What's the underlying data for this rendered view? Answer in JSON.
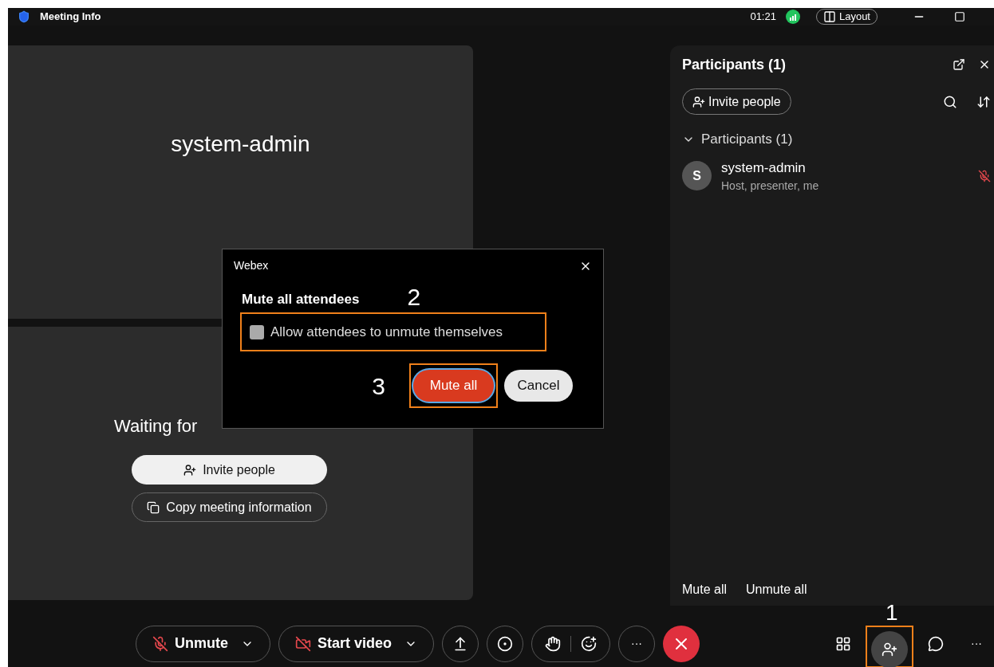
{
  "title_bar": {
    "title": "Meeting Info",
    "time": "01:21",
    "layout_button": "Layout"
  },
  "stage": {
    "main_name": "system-admin",
    "waiting_text": "Waiting for",
    "invite_button": "Invite people",
    "copy_button": "Copy meeting information"
  },
  "participants_panel": {
    "title": "Participants (1)",
    "invite_button": "Invite people",
    "group": {
      "label": "Participants (1)",
      "expanded": true
    },
    "participants": [
      {
        "initial": "S",
        "name": "system-admin",
        "role": "Host, presenter, me",
        "muted": true
      }
    ],
    "footer": [
      "Mute all",
      "Unmute all"
    ]
  },
  "dialog": {
    "title": "Webex",
    "heading": "Mute all attendees",
    "checkbox": {
      "label": "Allow attendees to unmute themselves",
      "checked": false
    },
    "primary_button": "Mute all",
    "secondary_button": "Cancel"
  },
  "toolbar": {
    "audio_button": "Unmute",
    "video_button": "Start video",
    "more": "···",
    "right_more": "···"
  },
  "annotations": [
    {
      "number": "1"
    },
    {
      "number": "2"
    },
    {
      "number": "3"
    }
  ]
}
